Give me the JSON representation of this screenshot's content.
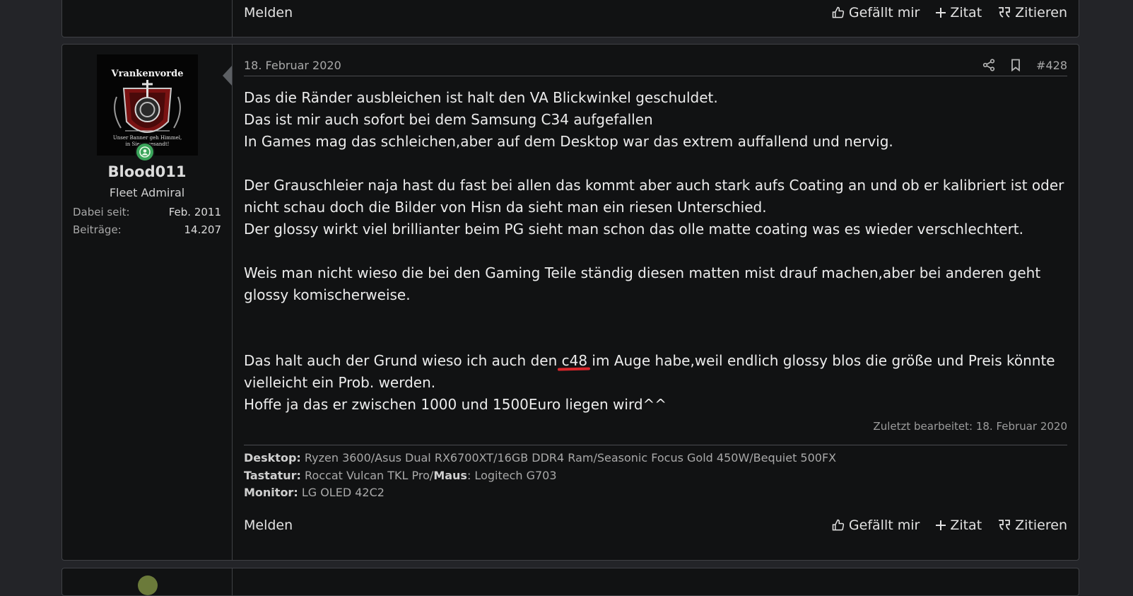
{
  "post_actions": {
    "report": "Melden",
    "like": "Gefällt mir",
    "quote_add": "Zitat",
    "quote": "Zitieren"
  },
  "user": {
    "avatar_text": "Vrankenvorde",
    "avatar_motto": "Unser Banner geh Himmel, in Siege gesandt!",
    "name": "Blood011",
    "title": "Fleet Admiral",
    "joined_label": "Dabei seit:",
    "joined_value": "Feb. 2011",
    "posts_label": "Beiträge:",
    "posts_value": "14.207",
    "online_color": "#3aa45a"
  },
  "post": {
    "date": "18. Februar 2020",
    "number": "#428",
    "paragraphs": [
      [
        "Das die Ränder ausbleichen ist halt den VA Blickwinkel geschuldet.",
        "Das ist mir auch sofort bei dem Samsung C34 aufgefallen",
        "In Games mag das schleichen,aber auf dem Desktop war das extrem auffallend und nervig."
      ],
      [
        "Der Grauschleier naja hast du fast bei allen das kommt aber auch stark aufs Coating an und ob er kalibriert ist oder nicht schau doch die Bilder von Hisn da sieht man ein riesen Unterschied.",
        "Der glossy wirkt viel brillianter beim PG sieht man schon das olle matte coating was es wieder verschlechtert."
      ],
      [
        "Weis man nicht wieso die bei den Gaming Teile ständig diesen matten mist drauf machen,aber bei anderen geht glossy komischerweise."
      ]
    ],
    "last_para_before": "Das halt auch der Grund wieso ich auch den ",
    "last_para_marked": "c48",
    "last_para_after": " im Auge habe,weil endlich glossy blos die größe und Preis könnte vielleicht ein Prob. werden.",
    "last_line": "Hoffe ja das er zwischen 1000 und 1500Euro liegen wird^^",
    "edited": "Zuletzt bearbeitet: 18. Februar 2020",
    "annotation_color": "#d8262b"
  },
  "signature": {
    "desktop_label": "Desktop:",
    "desktop_value": "Ryzen 3600/Asus Dual RX6700XT/16GB DDR4 Ram/Seasonic Focus Gold 450W/Bequiet 500FX",
    "keyboard_label": "Tastatur:",
    "keyboard_value": "Roccat Vulcan TKL Pro/",
    "mouse_label": "Maus",
    "mouse_value": ": Logitech G703",
    "monitor_label": "Monitor:",
    "monitor_value": "LG OLED 42C2"
  }
}
